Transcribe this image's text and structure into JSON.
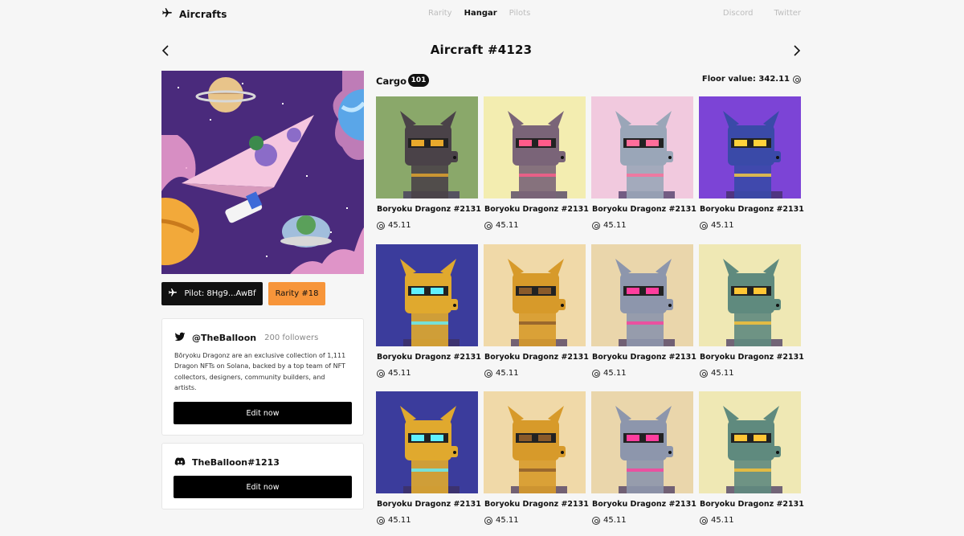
{
  "brand": {
    "name": "Aircrafts",
    "icon": "airplane-icon"
  },
  "nav": [
    {
      "label": "Rarity",
      "active": false
    },
    {
      "label": "Hangar",
      "active": true
    },
    {
      "label": "Pilots",
      "active": false
    }
  ],
  "social": [
    {
      "label": "Discord"
    },
    {
      "label": "Twitter"
    }
  ],
  "page": {
    "title": "Aircraft #4123"
  },
  "pilot": {
    "label": "Pilot: 8Hg9...AwBf"
  },
  "rarity": {
    "label": "Rarity #18"
  },
  "twitter_card": {
    "handle": "@TheBalloon",
    "followers": "200 followers",
    "bio": "Bōryoku Dragonz are an exclusive collection of 1,111 Dragon NFTs on Solana, backed by a top team of NFT collectors, designers, community builders, and artists.",
    "button": "Edit now"
  },
  "discord_card": {
    "handle": "TheBalloon#1213",
    "button": "Edit now"
  },
  "cargo": {
    "label": "Cargo",
    "count": "101",
    "floor": "Floor value: 342.11",
    "items": [
      {
        "name": "Boryoku Dragonz #2131",
        "price": "45.11",
        "bg": "#8aa86a",
        "skin": "#4a4248",
        "accent": "#e8a92c"
      },
      {
        "name": "Boryoku Dragonz #2131",
        "price": "45.11",
        "bg": "#f3edb0",
        "skin": "#7a6478",
        "accent": "#ff5b8a"
      },
      {
        "name": "Boryoku Dragonz #2131",
        "price": "45.11",
        "bg": "#f1c9de",
        "skin": "#9aa6b8",
        "accent": "#ff6d9a"
      },
      {
        "name": "Boryoku Dragonz #2131",
        "price": "45.11",
        "bg": "#7c44d6",
        "skin": "#3a4aa8",
        "accent": "#ffd23a"
      },
      {
        "name": "Boryoku Dragonz #2131",
        "price": "45.11",
        "bg": "#3b3c9c",
        "skin": "#e0a92e",
        "accent": "#5ff0ff"
      },
      {
        "name": "Boryoku Dragonz #2131",
        "price": "45.11",
        "bg": "#f0d9a8",
        "skin": "#d79a2a",
        "accent": "#8a5a2a"
      },
      {
        "name": "Boryoku Dragonz #2131",
        "price": "45.11",
        "bg": "#ead6ab",
        "skin": "#8d96ac",
        "accent": "#ff3e9e"
      },
      {
        "name": "Boryoku Dragonz #2131",
        "price": "45.11",
        "bg": "#efe8b4",
        "skin": "#5f8a7e",
        "accent": "#ffc635"
      },
      {
        "name": "Boryoku Dragonz #2131",
        "price": "45.11",
        "bg": "#3b3c9c",
        "skin": "#e0a92e",
        "accent": "#5ff0ff"
      },
      {
        "name": "Boryoku Dragonz #2131",
        "price": "45.11",
        "bg": "#f0d9a8",
        "skin": "#d79a2a",
        "accent": "#8a5a2a"
      },
      {
        "name": "Boryoku Dragonz #2131",
        "price": "45.11",
        "bg": "#ead6ab",
        "skin": "#8d96ac",
        "accent": "#ff3e9e"
      },
      {
        "name": "Boryoku Dragonz #2131",
        "price": "45.11",
        "bg": "#efe8b4",
        "skin": "#5f8a7e",
        "accent": "#ffc635"
      }
    ]
  }
}
